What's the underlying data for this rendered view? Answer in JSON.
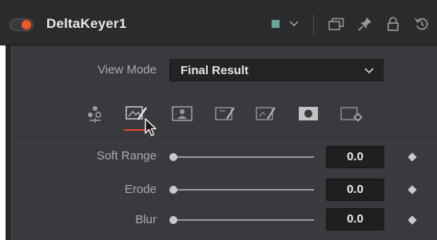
{
  "header": {
    "title": "DeltaKeyer1",
    "toggle_color": "#f0552a",
    "node_color": "#62a69c",
    "icons": [
      "version-icon",
      "pin-icon",
      "lock-icon",
      "reset-icon"
    ]
  },
  "view_mode": {
    "label": "View Mode",
    "value": "Final Result"
  },
  "tabs": [
    {
      "name": "key-tab",
      "icon": "nodes-icon"
    },
    {
      "name": "prematte-tab",
      "icon": "pick-matte-icon",
      "active": true
    },
    {
      "name": "matte-tab",
      "icon": "matte-image-icon"
    },
    {
      "name": "fringe-tab",
      "icon": "fringe-brush-icon"
    },
    {
      "name": "tuning-tab",
      "icon": "tuning-brush-icon"
    },
    {
      "name": "mask-tab",
      "icon": "mask-icon"
    },
    {
      "name": "settings-tab",
      "icon": "settings-gear-icon"
    }
  ],
  "controls": [
    {
      "label": "Soft Range",
      "value": "0.0",
      "level": 0.0
    },
    {
      "label": "Erode",
      "value": "0.0",
      "level": 0.0
    },
    {
      "label": "Blur",
      "value": "0.0",
      "level": 0.0
    }
  ]
}
